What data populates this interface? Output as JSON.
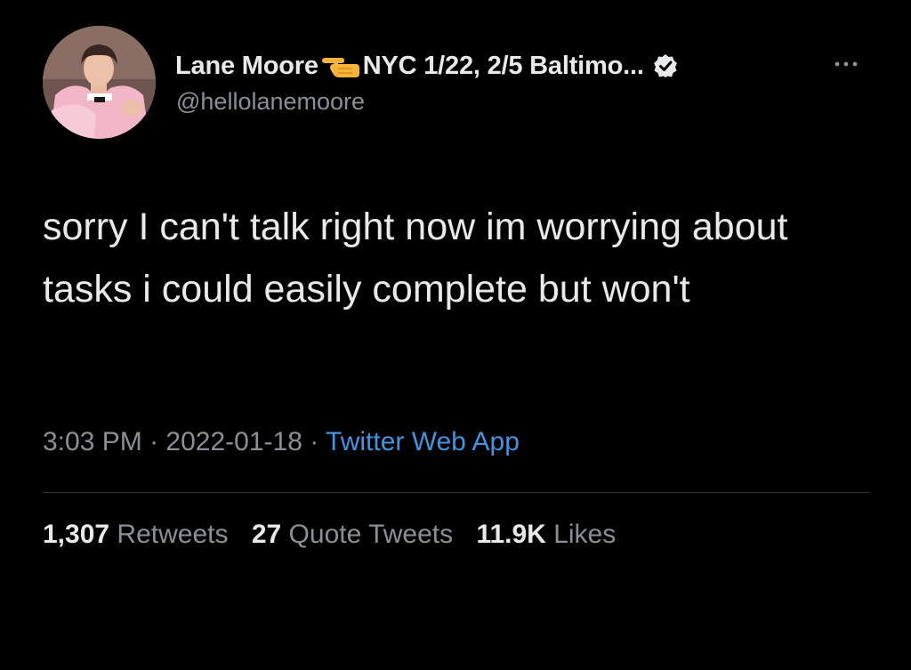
{
  "author": {
    "display_name": "Lane Moore",
    "name_suffix": "NYC 1/22, 2/5 Baltimo...",
    "emoji": "backhand-index-pointing-left",
    "handle": "@hellolanemoore",
    "verified": true
  },
  "tweet": {
    "text": "sorry I can't talk right now im worrying about tasks i could easily complete but won't",
    "time": "3:03 PM",
    "separator": "·",
    "date": "2022-01-18",
    "source": "Twitter Web App"
  },
  "stats": {
    "retweets_count": "1,307",
    "retweets_label": "Retweets",
    "quotes_count": "27",
    "quotes_label": "Quote Tweets",
    "likes_count": "11.9K",
    "likes_label": "Likes"
  },
  "colors": {
    "background": "#000000",
    "primary_text": "#e7e9ea",
    "secondary_text": "#8b9096",
    "link": "#3f95e0",
    "verified_badge": "#e7e9ea"
  }
}
